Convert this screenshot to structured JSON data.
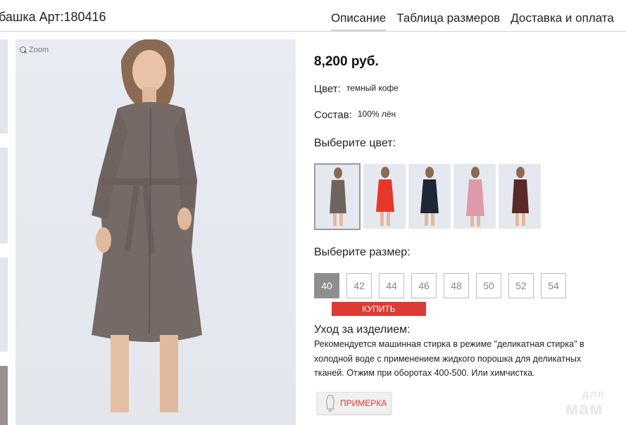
{
  "header": {
    "product_title": "башка Арт:180416",
    "tabs": [
      {
        "label": "Описание",
        "active": true
      },
      {
        "label": "Таблица размеров",
        "active": false
      },
      {
        "label": "Доставка и оплата",
        "active": false
      }
    ]
  },
  "gallery": {
    "zoom_label": "Zoom",
    "zoom_icon": "magnifier-icon"
  },
  "product": {
    "price": "8,200 руб.",
    "color_label": "Цвет:",
    "color_value": "темный кофе",
    "composition_label": "Состав:",
    "composition_value": "100% лён",
    "choose_color_label": "Выберите цвет:",
    "color_options": [
      {
        "name": "темный кофе",
        "hex": "#6f6360",
        "selected": true
      },
      {
        "name": "red",
        "hex": "#e8362a",
        "selected": false
      },
      {
        "name": "navy",
        "hex": "#1f2736",
        "selected": false
      },
      {
        "name": "pink",
        "hex": "#de9aa8",
        "selected": false
      },
      {
        "name": "burgundy",
        "hex": "#5a2a26",
        "selected": false
      }
    ],
    "choose_size_label": "Выберите размер:",
    "sizes": [
      {
        "label": "40",
        "selected": true
      },
      {
        "label": "42",
        "selected": false
      },
      {
        "label": "44",
        "selected": false
      },
      {
        "label": "46",
        "selected": false
      },
      {
        "label": "48",
        "selected": false
      },
      {
        "label": "50",
        "selected": false
      },
      {
        "label": "52",
        "selected": false
      },
      {
        "label": "54",
        "selected": false
      }
    ],
    "buy_label": "КУПИТЬ",
    "care_title": "Уход за изделием:",
    "care_text": "Рекомендуется машинная стирка в режиме \"деликатная стирка\" в холодной воде с применением жидкого порошка для деликатных тканей. Отжим при оборотах 400-500. Или химчистка.",
    "fitting_label": "ПРИМЕРКА",
    "fitting_icon": "mannequin-icon"
  },
  "watermark": {
    "top": "для",
    "bottom": "мам"
  },
  "colors": {
    "accent": "#dc3a34",
    "selected_size_bg": "#8e8e8e"
  }
}
